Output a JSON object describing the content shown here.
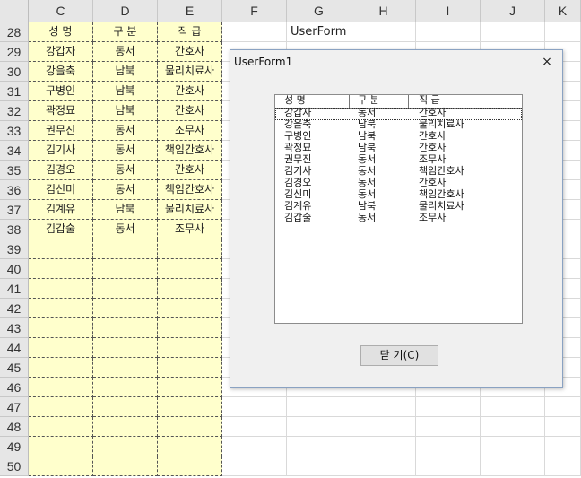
{
  "columns": [
    "C",
    "D",
    "E",
    "F",
    "G",
    "H",
    "I",
    "J",
    "K"
  ],
  "table": {
    "headers": [
      "성 명",
      "구 분",
      "직 급"
    ],
    "rows": [
      [
        "강갑자",
        "동서",
        "간호사"
      ],
      [
        "강을축",
        "남북",
        "물리치료사"
      ],
      [
        "구병인",
        "남북",
        "간호사"
      ],
      [
        "곽정묘",
        "남북",
        "간호사"
      ],
      [
        "권무진",
        "동서",
        "조무사"
      ],
      [
        "김기사",
        "동서",
        "책임간호사"
      ],
      [
        "김경오",
        "동서",
        "간호사"
      ],
      [
        "김신미",
        "동서",
        "책임간호사"
      ],
      [
        "김계유",
        "남북",
        "물리치료사"
      ],
      [
        "김갑술",
        "동서",
        "조무사"
      ]
    ]
  },
  "row_numbers": [
    "28",
    "29",
    "30",
    "31",
    "32",
    "33",
    "34",
    "35",
    "36",
    "37",
    "38",
    "39",
    "40",
    "41",
    "42",
    "43",
    "44",
    "45",
    "46",
    "47",
    "48",
    "49",
    "50"
  ],
  "sheet_button_label": "UserForm",
  "dialog": {
    "title": "UserForm1",
    "close_icon": "×",
    "list_headers": [
      "성 명",
      "구 분",
      "직 급"
    ],
    "list_rows": [
      [
        "강갑자",
        "동서",
        "간호사"
      ],
      [
        "강을축",
        "남북",
        "물리치료사"
      ],
      [
        "구병인",
        "남북",
        "간호사"
      ],
      [
        "곽정묘",
        "남북",
        "간호사"
      ],
      [
        "권무진",
        "동서",
        "조무사"
      ],
      [
        "김기사",
        "동서",
        "책임간호사"
      ],
      [
        "김경오",
        "동서",
        "간호사"
      ],
      [
        "김신미",
        "동서",
        "책임간호사"
      ],
      [
        "김계유",
        "남북",
        "물리치료사"
      ],
      [
        "김갑술",
        "동서",
        "조무사"
      ]
    ],
    "close_button_label": "닫 기(C)"
  }
}
